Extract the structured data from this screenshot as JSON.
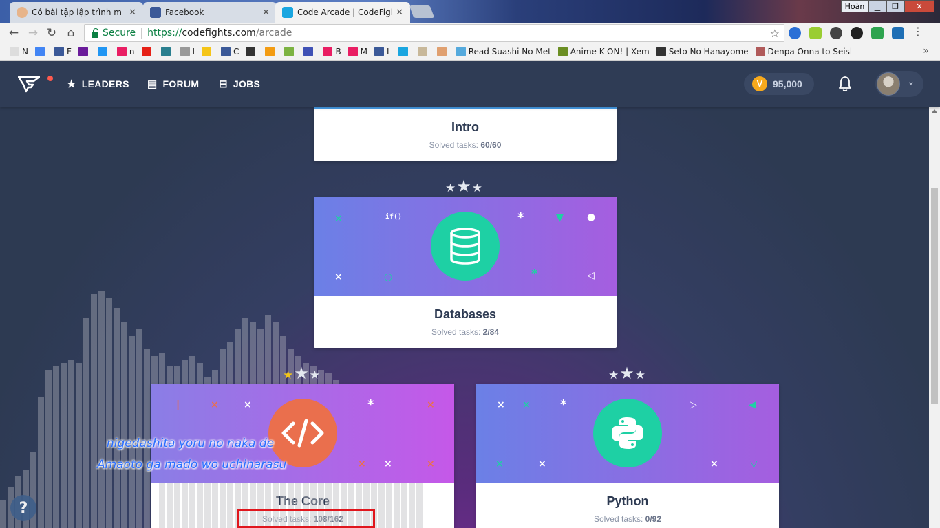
{
  "browser": {
    "tabs": [
      {
        "title": "Có bài tập lập trình m ng"
      },
      {
        "title": "Facebook"
      },
      {
        "title": "Code Arcade | CodeFigh"
      }
    ],
    "window_user": "Hoàn",
    "omnibox": {
      "secure_label": "Secure",
      "url_scheme": "https://",
      "url_host": "codefights.com",
      "url_path": "/arcade"
    },
    "bookmarks": [
      {
        "label": "N"
      },
      {
        "label": ""
      },
      {
        "label": "F"
      },
      {
        "label": ""
      },
      {
        "label": ""
      },
      {
        "label": "n"
      },
      {
        "label": ""
      },
      {
        "label": ""
      },
      {
        "label": "I"
      },
      {
        "label": ""
      },
      {
        "label": "C"
      },
      {
        "label": ""
      },
      {
        "label": ""
      },
      {
        "label": ""
      },
      {
        "label": ""
      },
      {
        "label": "B"
      },
      {
        "label": "M"
      },
      {
        "label": "L"
      },
      {
        "label": ""
      },
      {
        "label": ""
      },
      {
        "label": ""
      },
      {
        "label": "Read Suashi No Met"
      },
      {
        "label": "Anime K-ON! | Xem"
      },
      {
        "label": "Seto No Hanayome"
      },
      {
        "label": "Denpa Onna to Seish"
      }
    ],
    "more_label": "»"
  },
  "header": {
    "nav": [
      {
        "label": "LEADERS",
        "icon": "star-icon"
      },
      {
        "label": "FORUM",
        "icon": "chat-icon"
      },
      {
        "label": "JOBS",
        "icon": "briefcase-icon"
      }
    ],
    "coins": "95,000"
  },
  "arcade": {
    "cards": [
      {
        "title": "Intro",
        "tasks_label": "Solved tasks:",
        "tasks": "60/60"
      },
      {
        "title": "Databases",
        "tasks_label": "Solved tasks:",
        "tasks": "2/84",
        "code_glyph": "if()"
      },
      {
        "title": "The Core",
        "tasks_label": "Solved tasks:",
        "tasks": "108/162"
      },
      {
        "title": "Python",
        "tasks_label": "Solved tasks:",
        "tasks": "0/92"
      }
    ]
  },
  "overlay": {
    "lyrics_line1": "nigedashita yoru no naka de",
    "lyrics_line2": "Amaoto ga mado wo uchinarasu",
    "help_label": "?"
  },
  "colors": {
    "accent": "#1ed0a4",
    "core_badge": "#ea6f4d",
    "highlight": "#e0161d"
  }
}
